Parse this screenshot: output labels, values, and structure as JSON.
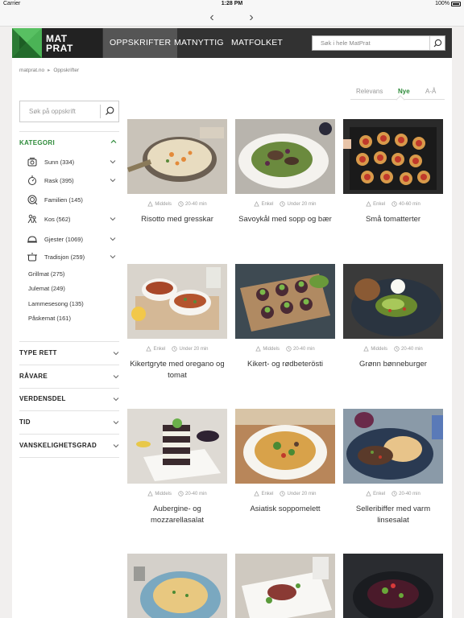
{
  "status_bar": {
    "carrier": "Carrier",
    "time": "1:28 PM",
    "battery": "100%"
  },
  "browser_nav": {
    "back": "‹",
    "forward": "›"
  },
  "header": {
    "logo_line1": "MAT",
    "logo_line2": "PRAT",
    "nav": [
      {
        "label": "OPPSKRIFTER",
        "active": true
      },
      {
        "label": "MATNYTTIG",
        "active": false
      },
      {
        "label": "MATFOLKET",
        "active": false
      }
    ],
    "search_placeholder": "Søk i hele MatPrat"
  },
  "breadcrumb": {
    "home": "matprat.no",
    "current": "Oppskrifter"
  },
  "sort": {
    "options": [
      "Relevans",
      "Nye",
      "A-Å"
    ],
    "active": "Nye"
  },
  "sidebar": {
    "search_placeholder": "Søk på oppskrift",
    "kategori_title": "KATEGORI",
    "categories": [
      {
        "label": "Sunn (334)",
        "icon": "scale-icon",
        "expandable": true
      },
      {
        "label": "Rask (395)",
        "icon": "stopwatch-icon",
        "expandable": true
      },
      {
        "label": "Familien (145)",
        "icon": "plate-icon",
        "expandable": false
      },
      {
        "label": "Kos (562)",
        "icon": "people-icon",
        "expandable": true
      },
      {
        "label": "Gjester (1069)",
        "icon": "cloche-icon",
        "expandable": true
      },
      {
        "label": "Tradisjon (259)",
        "icon": "pot-icon",
        "expandable": true
      }
    ],
    "subcategories": [
      "Grillmat (275)",
      "Julemat (249)",
      "Lammesesong (135)",
      "Påskemat (161)"
    ],
    "filters": [
      "TYPE RETT",
      "RÅVARE",
      "VERDENSDEL",
      "TID",
      "VANSKELIGHETSGRAD"
    ]
  },
  "recipes": [
    {
      "title": "Risotto med gresskar",
      "difficulty": "Middels",
      "time": "20-40 min"
    },
    {
      "title": "Savoykål med sopp og bær",
      "difficulty": "Enkel",
      "time": "Under 20 min"
    },
    {
      "title": "Små tomatterter",
      "difficulty": "Enkel",
      "time": "40-60 min"
    },
    {
      "title": "Kikertgryte med oregano og tomat",
      "difficulty": "Enkel",
      "time": "Under 20 min"
    },
    {
      "title": "Kikert- og rødbeterösti",
      "difficulty": "Middels",
      "time": "20-40 min"
    },
    {
      "title": "Grønn bønneburger",
      "difficulty": "Middels",
      "time": "20-40 min"
    },
    {
      "title": "Aubergine- og mozzarellasalat",
      "difficulty": "Middels",
      "time": "20-40 min"
    },
    {
      "title": "Asiatisk soppomelett",
      "difficulty": "Enkel",
      "time": "Under 20 min"
    },
    {
      "title": "Selleribiffer med varm linsesalat",
      "difficulty": "Enkel",
      "time": "20-40 min"
    }
  ],
  "colors": {
    "accent": "#2e8b3a",
    "header": "#323232"
  }
}
